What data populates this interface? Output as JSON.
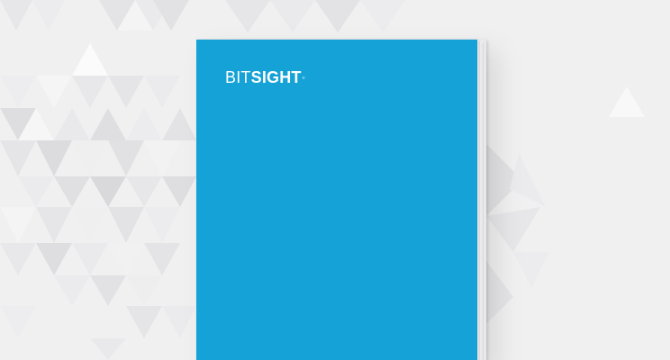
{
  "brand": {
    "name_light": "BIT",
    "name_bold": "SIGHT",
    "trademark": "®"
  },
  "colors": {
    "background": "#f0f0f1",
    "cover": "#15a2d6",
    "logo_text": "#ffffff"
  }
}
